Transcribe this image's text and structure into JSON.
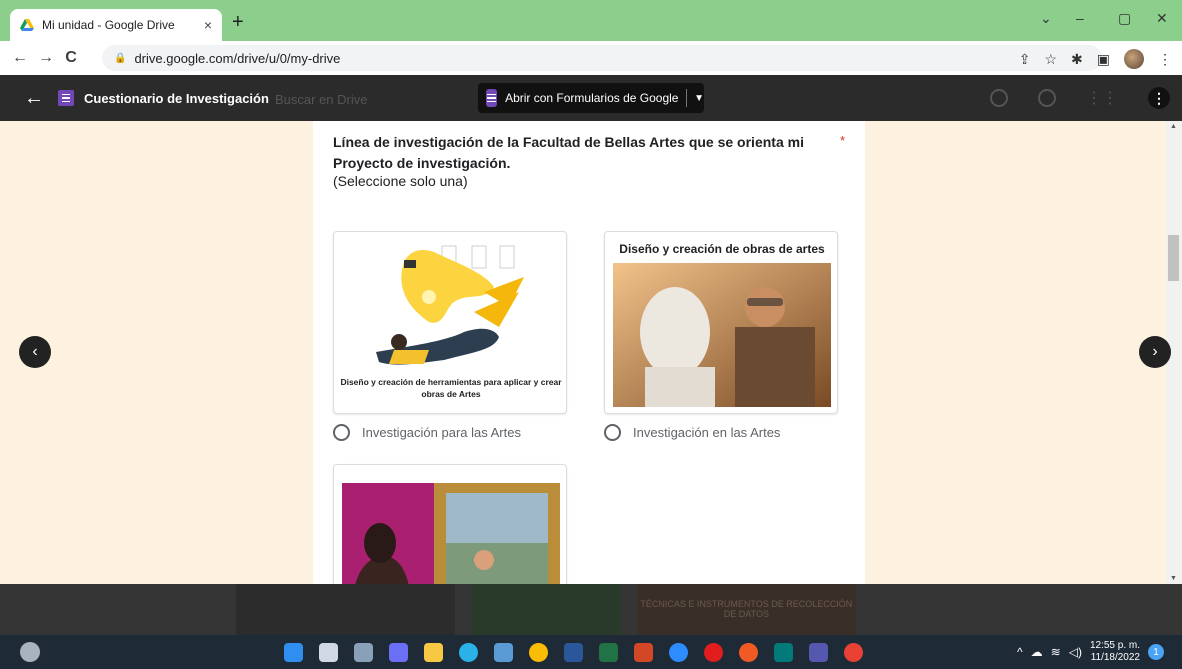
{
  "browser": {
    "tab_title": "Mi unidad - Google Drive",
    "tab_close": "×",
    "new_tab": "+",
    "url": "drive.google.com/drive/u/0/my-drive",
    "window_controls": [
      "⌄",
      "–",
      "▢",
      "✕"
    ]
  },
  "viewer": {
    "back": "←",
    "file_title": "Cuestionario de Investigación",
    "behind_search": "Buscar en Drive",
    "open_with": "Abrir con Formularios de Google",
    "more": "⋮"
  },
  "form": {
    "question": "Línea de investigación de la Facultad de Bellas Artes que se orienta mi Proyecto de investigación.",
    "required_mark": "*",
    "instruction": "(Seleccione solo una)",
    "options": [
      {
        "image_caption": "Diseño y creación de herramientas para aplicar y crear obras de Artes",
        "label": "Investigación para las Artes"
      },
      {
        "image_caption": "Diseño y creación de obras de artes",
        "label": "Investigación en las Artes"
      },
      {
        "image_caption": "",
        "label": ""
      }
    ]
  },
  "nav": {
    "prev": "‹",
    "next": "›"
  },
  "background_text": "TÉCNICAS E INSTRUMENTOS DE RECOLECCIÓN DE DATOS",
  "taskbar": {
    "time": "12:55 p. m.",
    "date": "11/18/2022",
    "notifications": "1",
    "icons": [
      "windows-start",
      "search",
      "task-view",
      "chat",
      "file-explorer",
      "edge",
      "store",
      "chrome",
      "word",
      "excel",
      "powerpoint",
      "zoom",
      "opera",
      "brave",
      "publisher",
      "teams",
      "chrome-profile"
    ],
    "icon_colors": [
      "#2f8ef0",
      "#cfd8e3",
      "#8aa0b8",
      "#6a6ff5",
      "#f7c844",
      "#2ab2e8",
      "#5a9bd5",
      "#fbbc05",
      "#2b579a",
      "#217346",
      "#d24726",
      "#2d8cff",
      "#e11d1d",
      "#f15a24",
      "#037a7a",
      "#5558af",
      "#e94235"
    ]
  }
}
